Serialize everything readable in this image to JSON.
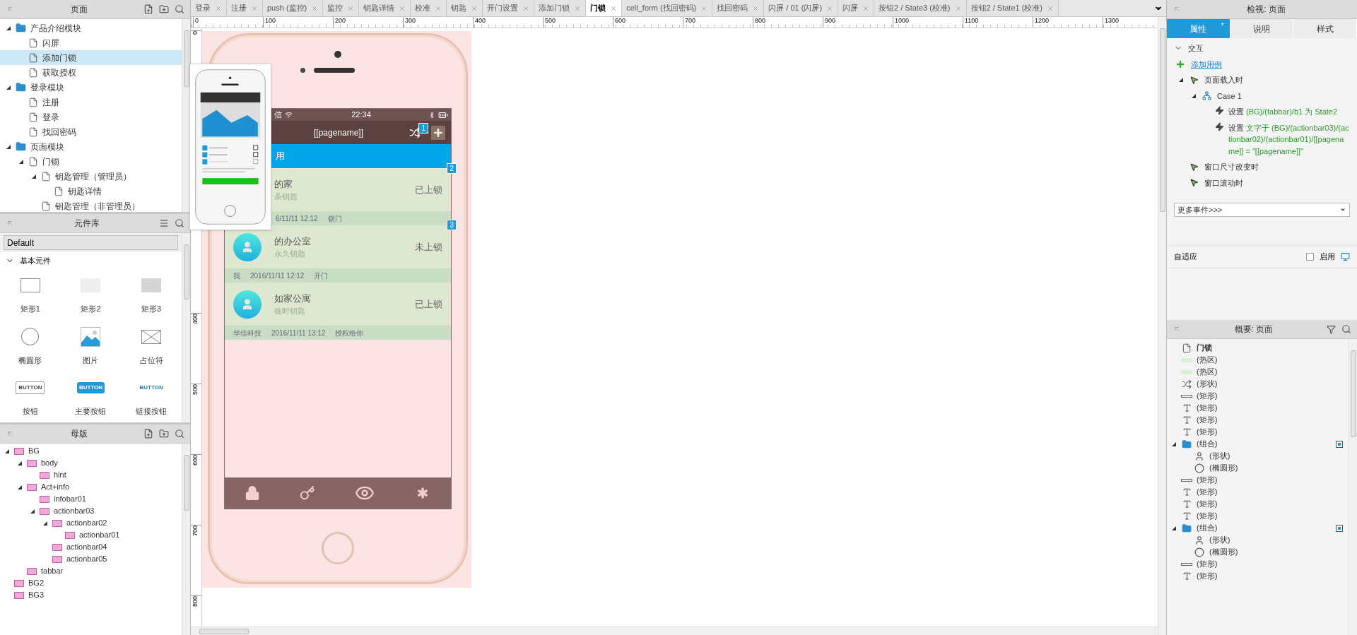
{
  "pages_panel": {
    "title": "页面",
    "tree": [
      {
        "label": "产品介绍模块",
        "kind": "folder",
        "expanded": true,
        "selected": false,
        "children": [
          {
            "label": "闪屏",
            "kind": "page",
            "selected": false
          },
          {
            "label": "添加门锁",
            "kind": "page",
            "selected": true
          },
          {
            "label": "获取授权",
            "kind": "page",
            "selected": false
          }
        ]
      },
      {
        "label": "登录模块",
        "kind": "folder",
        "expanded": true,
        "selected": false,
        "children": [
          {
            "label": "注册",
            "kind": "page",
            "selected": false
          },
          {
            "label": "登录",
            "kind": "page",
            "selected": false
          },
          {
            "label": "找回密码",
            "kind": "page",
            "selected": false
          }
        ]
      },
      {
        "label": "页面模块",
        "kind": "folder",
        "expanded": true,
        "selected": false,
        "children": [
          {
            "label": "门锁",
            "kind": "page",
            "expanded": true,
            "selected": false,
            "children": [
              {
                "label": "钥匙管理（管理员）",
                "kind": "page",
                "expanded": true,
                "selected": false,
                "children": [
                  {
                    "label": "钥匙详情",
                    "kind": "page",
                    "selected": false
                  }
                ]
              },
              {
                "label": "钥匙管理（非管理员）",
                "kind": "page",
                "selected": false
              }
            ]
          }
        ]
      }
    ]
  },
  "library_panel": {
    "title": "元件库",
    "library": "Default",
    "section": "基本元件",
    "widgets": [
      {
        "label": "矩形1",
        "kind": "rect-outline"
      },
      {
        "label": "矩形2",
        "kind": "rect-light"
      },
      {
        "label": "矩形3",
        "kind": "rect-gray"
      },
      {
        "label": "椭圆形",
        "kind": "ellipse"
      },
      {
        "label": "图片",
        "kind": "image"
      },
      {
        "label": "占位符",
        "kind": "placeholder"
      },
      {
        "label": "按钮",
        "kind": "button",
        "sample": "BUTTON"
      },
      {
        "label": "主要按钮",
        "kind": "primary-button",
        "sample": "BUTTON"
      },
      {
        "label": "链接按钮",
        "kind": "link-button",
        "sample": "BUTTON"
      }
    ]
  },
  "masters_panel": {
    "title": "母版",
    "tree": [
      {
        "label": "BG",
        "expanded": true,
        "children": [
          {
            "label": "body",
            "expanded": true,
            "children": [
              {
                "label": "hint"
              }
            ]
          },
          {
            "label": "Act+info",
            "expanded": true,
            "children": [
              {
                "label": "infobar01"
              },
              {
                "label": "actionbar03",
                "expanded": true,
                "children": [
                  {
                    "label": "actionbar02",
                    "expanded": true,
                    "children": [
                      {
                        "label": "actionbar01"
                      }
                    ]
                  },
                  {
                    "label": "actionbar04"
                  },
                  {
                    "label": "actionbar05"
                  }
                ]
              }
            ]
          },
          {
            "label": "tabbar"
          }
        ]
      },
      {
        "label": "BG2"
      },
      {
        "label": "BG3"
      }
    ]
  },
  "tabs": [
    {
      "label": "登录",
      "selected": false
    },
    {
      "label": "注册",
      "selected": false
    },
    {
      "label": "push (监控)",
      "selected": false
    },
    {
      "label": "监控",
      "selected": false
    },
    {
      "label": "钥匙详情",
      "selected": false
    },
    {
      "label": "校准",
      "selected": false
    },
    {
      "label": "钥匙",
      "selected": false
    },
    {
      "label": "开门设置",
      "selected": false
    },
    {
      "label": "添加门锁",
      "selected": false
    },
    {
      "label": "门锁",
      "selected": true
    },
    {
      "label": "cell_form (找回密码)",
      "selected": false
    },
    {
      "label": "找回密码",
      "selected": false
    },
    {
      "label": "闪屏 / 01 (闪屏)",
      "selected": false
    },
    {
      "label": "闪屏",
      "selected": false
    },
    {
      "label": "按钮2 / State3 (校准)",
      "selected": false
    },
    {
      "label": "按钮2 / State1 (校准)",
      "selected": false
    }
  ],
  "ruler": {
    "x_labels": [
      "0",
      "100",
      "200",
      "300",
      "400",
      "500",
      "600",
      "700",
      "800",
      "900",
      "1000",
      "1100",
      "1200",
      "1300"
    ],
    "y_labels": [
      "0",
      "400",
      "500",
      "600",
      "700",
      "800"
    ]
  },
  "phone": {
    "carrier": "信",
    "time": "22:34",
    "title": "[[pagename]]",
    "markers": [
      "1",
      "2",
      "3"
    ],
    "banner": "用",
    "keys": [
      {
        "name": "的家",
        "sub": "条钥匙",
        "status": "已上锁",
        "log": [
          "6/11/11 12:12",
          "锁门"
        ]
      },
      {
        "name": "的办公室",
        "sub": "永久钥匙",
        "status": "未上锁",
        "log": [
          "我",
          "2016/11/11 12:12",
          "开门"
        ]
      },
      {
        "name": "如家公寓",
        "sub": "临时钥匙",
        "status": "已上锁",
        "log": [
          "华佳科技",
          "2016/11/11 13:12",
          "授权给你"
        ]
      }
    ]
  },
  "inspector": {
    "title": "检视: 页面",
    "tabs": [
      {
        "label": "属性",
        "selected": true,
        "mark": "*"
      },
      {
        "label": "说明",
        "selected": false
      },
      {
        "label": "样式",
        "selected": false
      }
    ],
    "section": "交互",
    "expanded": true,
    "add_case": "添加用例",
    "events": [
      {
        "label": "页面载入时",
        "expanded": true,
        "cases": [
          {
            "label": "Case 1",
            "expanded": true,
            "actions": [
              {
                "verb": "设置",
                "text": "(BG)/(tabbar)/b1 为 State2"
              },
              {
                "verb": "设置",
                "text": "文字于 (BG)/(actionbar03)/(actionbar02)/(actionbar01)/[[pagename]] = \"[[pagename]]\""
              }
            ]
          }
        ]
      },
      {
        "label": "窗口尺寸改变时"
      },
      {
        "label": "窗口滚动时"
      }
    ],
    "more_events": "更多事件>>>",
    "adaptive": "自适应",
    "enable": {
      "label": "启用",
      "checked": false
    }
  },
  "outline": {
    "title": "概要: 页面",
    "items": [
      {
        "label": "门锁",
        "kind": "page"
      },
      {
        "label": "(热区)",
        "kind": "hotspot"
      },
      {
        "label": "(热区)",
        "kind": "hotspot"
      },
      {
        "label": "(形状)",
        "kind": "shuffle"
      },
      {
        "label": "(矩形)",
        "kind": "rect"
      },
      {
        "label": "(矩形)",
        "kind": "text"
      },
      {
        "label": "(矩形)",
        "kind": "text"
      },
      {
        "label": "(矩形)",
        "kind": "text"
      },
      {
        "label": "(组合)",
        "kind": "group",
        "expanded": true,
        "children": [
          {
            "label": "(形状)",
            "kind": "person"
          },
          {
            "label": "(椭圆形)",
            "kind": "ellipse"
          }
        ]
      },
      {
        "label": "(矩形)",
        "kind": "rect"
      },
      {
        "label": "(矩形)",
        "kind": "text"
      },
      {
        "label": "(矩形)",
        "kind": "text"
      },
      {
        "label": "(矩形)",
        "kind": "text"
      },
      {
        "label": "(组合)",
        "kind": "group",
        "expanded": true,
        "children": [
          {
            "label": "(形状)",
            "kind": "person"
          },
          {
            "label": "(椭圆形)",
            "kind": "ellipse"
          }
        ]
      },
      {
        "label": "(矩形)",
        "kind": "rect"
      },
      {
        "label": "(矩形)",
        "kind": "text"
      }
    ]
  }
}
